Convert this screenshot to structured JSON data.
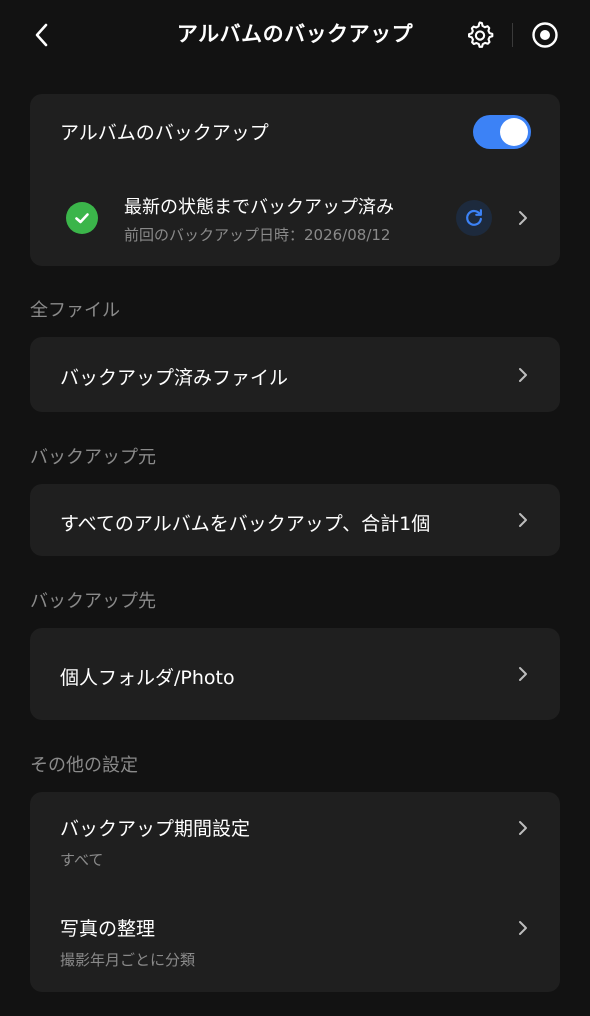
{
  "header": {
    "title": "アルバムのバックアップ"
  },
  "backup_card": {
    "toggle_label": "アルバムのバックアップ",
    "toggle_on": true,
    "status_title": "最新の状態までバックアップ済み",
    "status_sub": "前回のバックアップ日時：2026/08/12"
  },
  "sections": {
    "all_files": "全ファイル",
    "source": "バックアップ元",
    "destination": "バックアップ先",
    "other": "その他の設定"
  },
  "rows": {
    "backed_up_files": "バックアップ済みファイル",
    "source_value": "すべてのアルバムをバックアップ、合計1個",
    "destination_value": "個人フォルダ/Photo",
    "period_title": "バックアップ期間設定",
    "period_value": "すべて",
    "organize_title": "写真の整理",
    "organize_value": "撮影年月ごとに分類"
  },
  "colors": {
    "background": "#121212",
    "card": "#1f1f1f",
    "accent": "#3c82f6",
    "success": "#3bb54a",
    "secondary_text": "#8a8a8a"
  },
  "icons": [
    "back-arrow-icon",
    "gear-icon",
    "record-icon",
    "check-icon",
    "refresh-icon",
    "chevron-right-icon"
  ]
}
